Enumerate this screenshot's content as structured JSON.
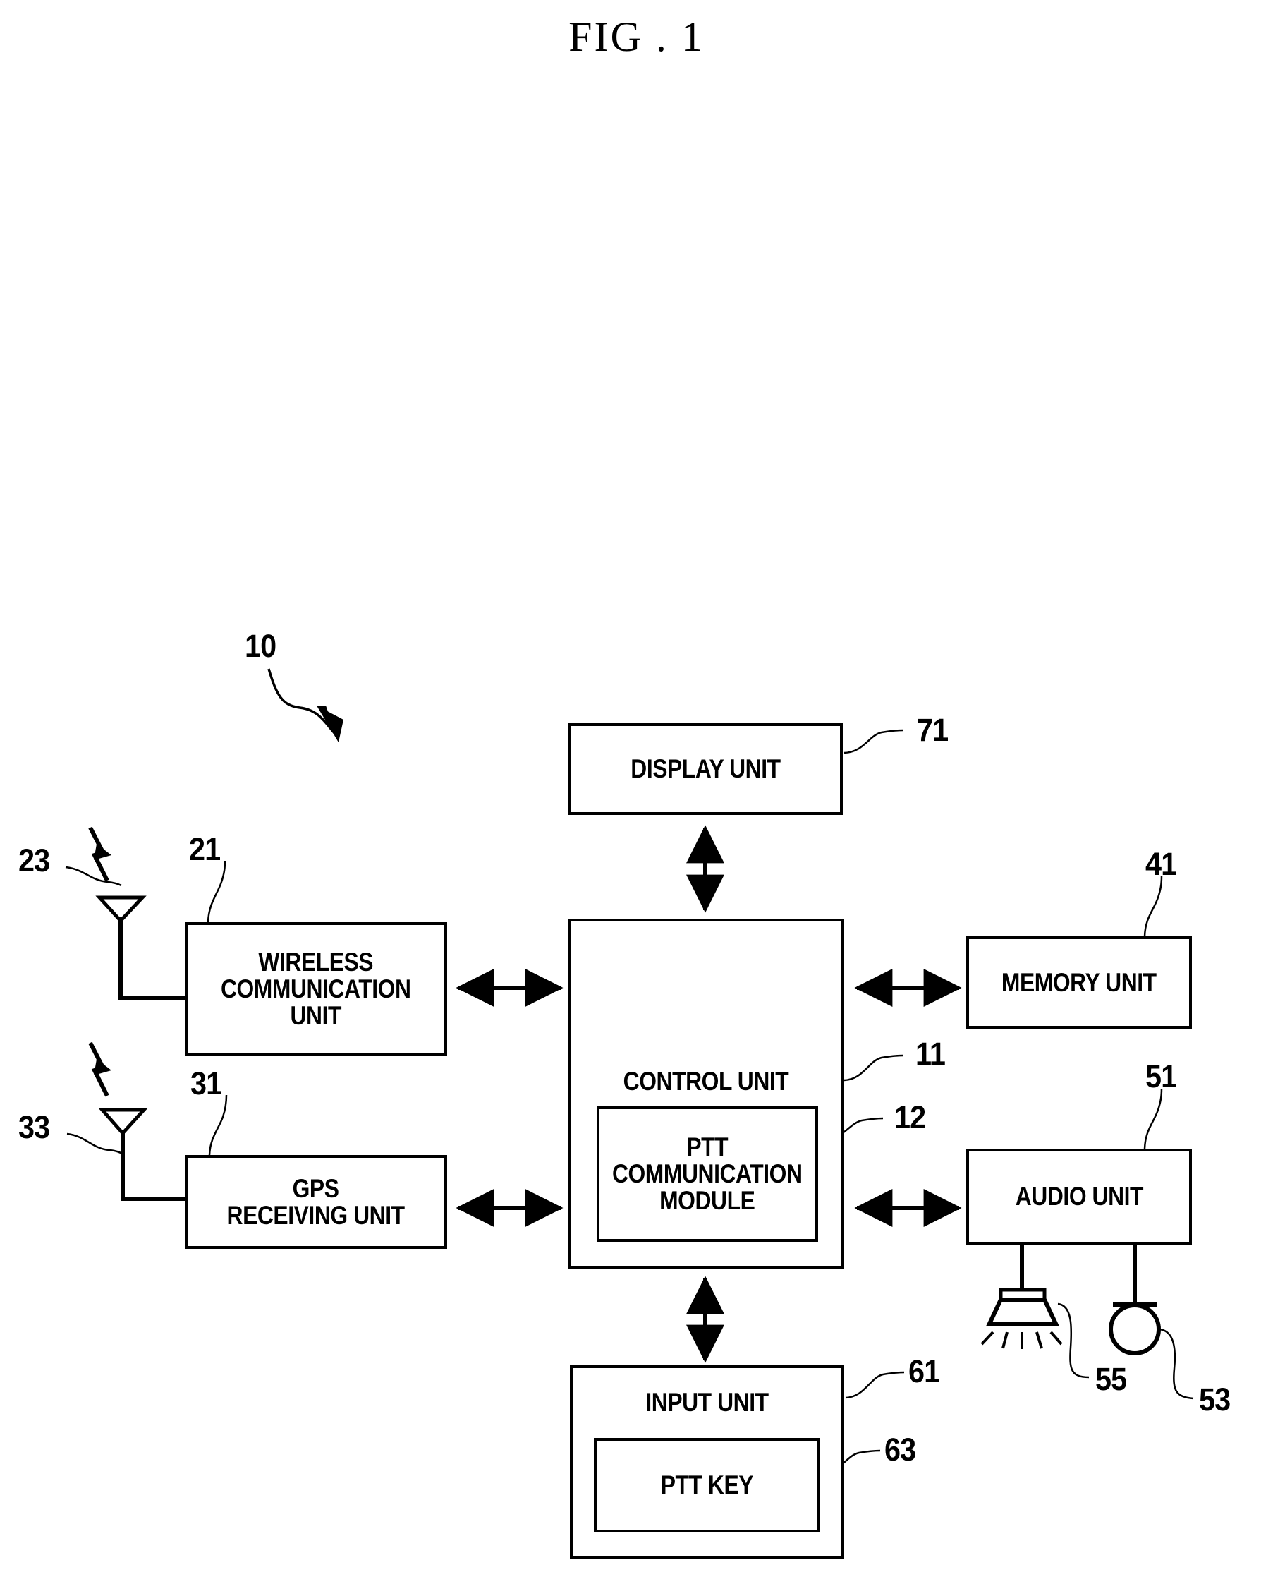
{
  "figure": {
    "title": "FIG . 1",
    "system_ref": "10"
  },
  "blocks": [
    {
      "id": "display_unit",
      "label": "DISPLAY UNIT",
      "ref": "71"
    },
    {
      "id": "wireless_comm",
      "label": "WIRELESS\nCOMMUNICATION\nUNIT",
      "ref": "21"
    },
    {
      "id": "gps_receiving",
      "label": "GPS\nRECEIVING UNIT",
      "ref": "31"
    },
    {
      "id": "control_unit",
      "label": "CONTROL UNIT",
      "ref": "11"
    },
    {
      "id": "ptt_comm_module",
      "label": "PTT\nCOMMUNICATION\nMODULE",
      "ref": "12"
    },
    {
      "id": "memory_unit",
      "label": "MEMORY UNIT",
      "ref": "41"
    },
    {
      "id": "audio_unit",
      "label": "AUDIO UNIT",
      "ref": "51"
    },
    {
      "id": "input_unit",
      "label": "INPUT UNIT",
      "ref": "61"
    },
    {
      "id": "ptt_key",
      "label": "PTT KEY",
      "ref": "63"
    }
  ],
  "icons": [
    {
      "id": "wireless_antenna",
      "name": "antenna-icon",
      "ref": "23"
    },
    {
      "id": "gps_antenna",
      "name": "antenna-icon",
      "ref": "33"
    },
    {
      "id": "speaker",
      "name": "speaker-icon",
      "ref": "55"
    },
    {
      "id": "microphone",
      "name": "microphone-icon",
      "ref": "53"
    }
  ],
  "refs": {
    "system": "10",
    "wireless_comm": "21",
    "wireless_antenna": "23",
    "gps_receiving": "31",
    "gps_antenna": "33",
    "control_unit": "11",
    "ptt_comm_module": "12",
    "memory_unit": "41",
    "audio_unit": "51",
    "microphone": "53",
    "speaker": "55",
    "input_unit": "61",
    "ptt_key": "63",
    "display_unit": "71"
  },
  "colors": {
    "ink": "#000000",
    "paper": "#ffffff"
  }
}
